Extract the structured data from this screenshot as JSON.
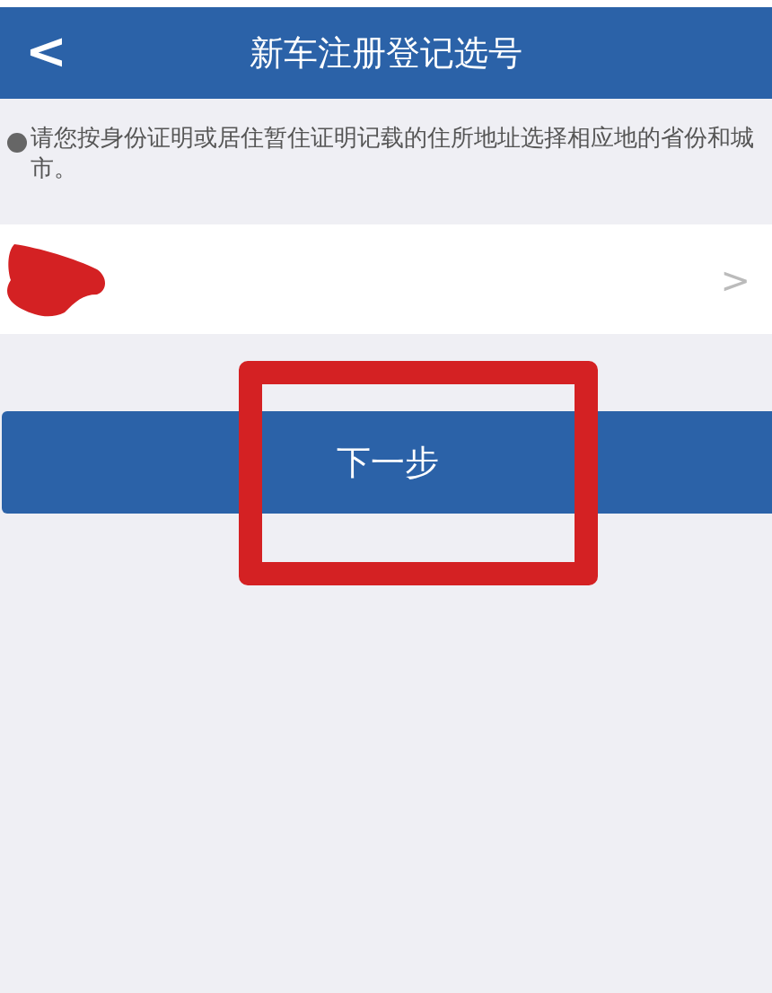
{
  "header": {
    "back_icon": "<",
    "title": "新车注册登记选号"
  },
  "notice": "请您按身份证明或居住暂住证明记载的住所地址选择相应地的省份和城市。",
  "location_row": {
    "chevron": ">"
  },
  "next_button": {
    "label": "下一步"
  }
}
